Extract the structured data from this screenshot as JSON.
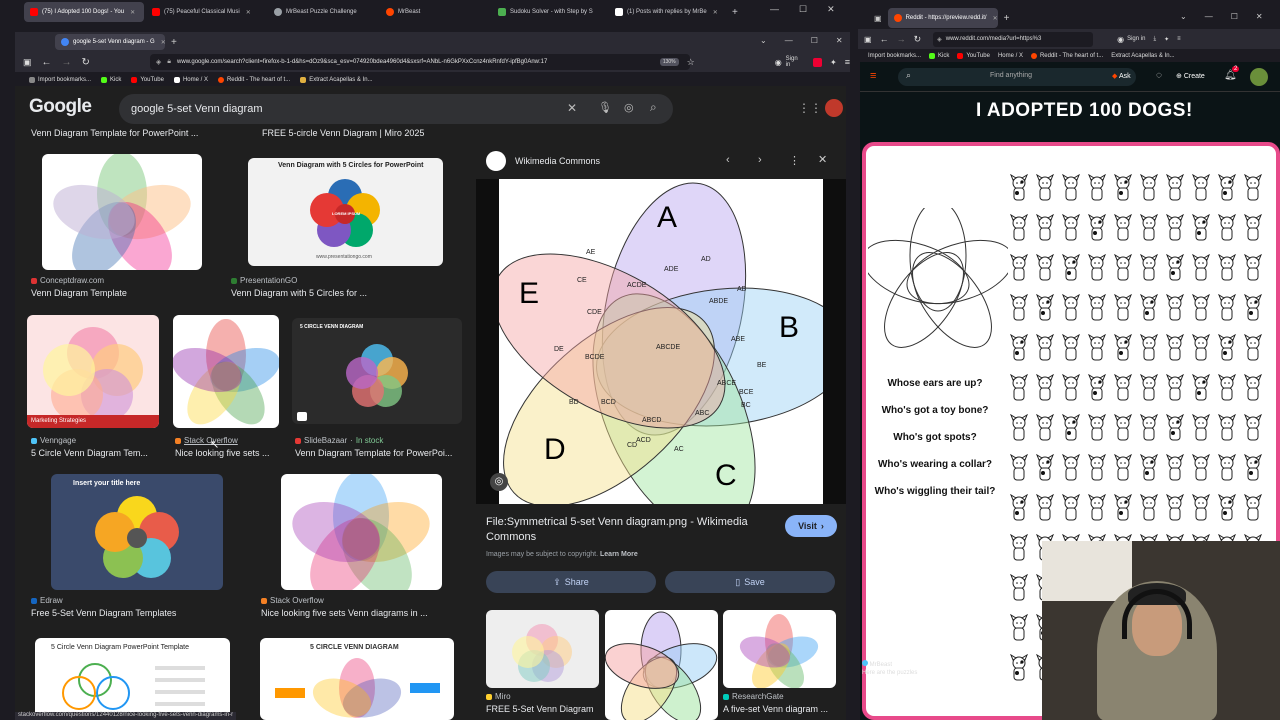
{
  "left_window": {
    "tabs": [
      {
        "label": "(75) I Adopted 100 Dogs! - You",
        "color": "#ff0000"
      },
      {
        "label": "(75) Peaceful Classical Musi",
        "color": "#ff0000"
      },
      {
        "label": "MrBeast Puzzle Challenge",
        "color": "#9aa0a6"
      },
      {
        "label": "MrBeast",
        "color": "#ff4500"
      },
      {
        "label": "Sudoku Solver - with Step by S",
        "color": "#4caf50"
      },
      {
        "label": "(1) Posts with replies by MrBe",
        "color": "#ffffff"
      }
    ],
    "inner_tab": "google 5-set Venn diagram - G",
    "url": "www.google.com/search?client=firefox-b-1-d&hs=dOz9&sca_esv=074920bdea4960d4&sxsrf=ANbL-n6GkPXxCcnz4nkRnfdY-ipfBg0Anw:17",
    "zoom": "130%",
    "sign_in": "Sign in",
    "bookmarks": [
      "Import bookmarks...",
      "Kick",
      "YouTube",
      "Home / X",
      "Reddit - The heart of t...",
      "Extract Acapellas & In..."
    ]
  },
  "google": {
    "logo": "Google",
    "query": "google 5-set Venn diagram",
    "top_captions": [
      "Venn Diagram Template for PowerPoint ...",
      "FREE 5-circle Venn Diagram | Miro 2025"
    ],
    "results": [
      {
        "source": "Conceptdraw.com",
        "title": "Venn Diagram Template"
      },
      {
        "source": "PresentationGO",
        "title": "Venn Diagram with 5 Circles for ..."
      },
      {
        "source": "Venngage",
        "title": "5 Circle Venn Diagram Tem..."
      },
      {
        "source": "Stack Overflow",
        "title": "Nice looking five sets ..."
      },
      {
        "source": "SlideBazaar",
        "stock": "In stock",
        "title": "Venn Diagram Template for PowerPoi..."
      },
      {
        "source": "Edraw",
        "title": "Free 5-Set Venn Diagram Templates"
      },
      {
        "source": "Stack Overflow",
        "title": "Nice looking five sets Venn diagrams in ..."
      }
    ],
    "thumb_texts": {
      "pgo_title": "Venn Diagram with 5 Circles for PowerPoint",
      "pgo_center": "LOREM IPSUM",
      "pgo_footer": "www.presentationgo.com",
      "venngage_label": "Marketing Strategies",
      "slidebazaar_title": "5 CIRCLE VENN DIAGRAM",
      "edraw_title": "Insert your title here",
      "ppt_title": "5 Circle Venn Diagram PowerPoint Template",
      "five_circle_title": "5 CIRCLE VENN DIAGRAM"
    },
    "status_url": "stackoverflow.com/questions/12440128/nice-looking-five-sets-venn-diagrams-in-r"
  },
  "preview": {
    "site": "Wikimedia Commons",
    "title": "File:Symmetrical 5-set Venn diagram.png - Wikimedia Commons",
    "visit": "Visit",
    "copyright": "Images may be subject to copyright.",
    "learn_more": "Learn More",
    "share": "Share",
    "save": "Save",
    "sets": [
      "A",
      "B",
      "C",
      "D",
      "E"
    ],
    "region_labels": [
      "AE",
      "ADE",
      "AD",
      "AB",
      "CE",
      "ACDE",
      "ABDE",
      "CDE",
      "ABCDE",
      "ABE",
      "DE",
      "BCDE",
      "BE",
      "ABCE",
      "BCE",
      "BC",
      "BD",
      "BCD",
      "ABCD",
      "ABC",
      "CD",
      "ACD",
      "AC"
    ],
    "related": [
      {
        "source": "Miro",
        "title": "FREE 5-Set Venn Diagram ..."
      },
      {
        "source": "",
        "title": ""
      },
      {
        "source": "ResearchGate",
        "title": "A five-set Venn diagram ..."
      }
    ]
  },
  "right_window": {
    "tab": "Reddit - https://preview.redd.it/",
    "url": "www.reddit.com/media?url=https%3",
    "sign_in": "Sign in",
    "bookmarks": [
      "Import bookmarks...",
      "Kick",
      "YouTube",
      "Home / X",
      "Reddit - The heart of t...",
      "Extract Acapellas & In..."
    ],
    "search_placeholder": "Find anything",
    "ask": "Ask",
    "create": "Create",
    "notif_count": "2",
    "banner": "I ADOPTED 100 DOGS!",
    "questions": [
      "Whose ears are up?",
      "Who's got a toy bone?",
      "Who's got spots?",
      "Who's wearing a collar?",
      "Who's wiggling their tail?"
    ],
    "footer_user": "MrBeast",
    "footer_text": "Here are the puzzles"
  }
}
